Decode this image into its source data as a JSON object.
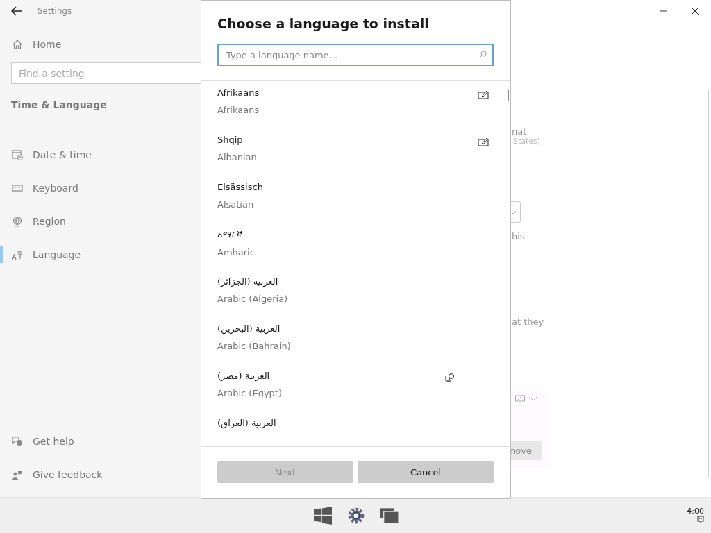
{
  "window": {
    "title": "Settings"
  },
  "sidebar": {
    "home": "Home",
    "search": {
      "placeholder": "Find a setting"
    },
    "section": "Time & Language",
    "items": [
      {
        "label": "Date & time",
        "selected": false
      },
      {
        "label": "Keyboard",
        "selected": false
      },
      {
        "label": "Region",
        "selected": false
      },
      {
        "label": "Language",
        "selected": true
      }
    ],
    "footer": [
      "Get help",
      "Give feedback"
    ]
  },
  "background": {
    "texts": [
      "nat",
      "States)",
      "his",
      "at they"
    ],
    "button": "nove"
  },
  "dialog": {
    "title": "Choose a language to install",
    "search": {
      "placeholder": "Type a language name..."
    },
    "languages": [
      {
        "native": "Afrikaans",
        "english": "Afrikaans",
        "handwriting": true,
        "speech": false
      },
      {
        "native": "Shqip",
        "english": "Albanian",
        "handwriting": true,
        "speech": false
      },
      {
        "native": "Elsässisch",
        "english": "Alsatian",
        "handwriting": false,
        "speech": false
      },
      {
        "native": "አማርኛ",
        "english": "Amharic",
        "handwriting": false,
        "speech": false
      },
      {
        "native": "العربية (الجزائر)",
        "english": "Arabic (Algeria)",
        "handwriting": false,
        "speech": false
      },
      {
        "native": "العربية (البحرين)",
        "english": "Arabic (Bahrain)",
        "handwriting": false,
        "speech": false
      },
      {
        "native": "العربية (مصر)",
        "english": "Arabic (Egypt)",
        "handwriting": false,
        "speech": true
      },
      {
        "native": "العربية (العراق)",
        "handwriting": false,
        "speech": false
      }
    ],
    "buttons": [
      {
        "label": "Next",
        "disabled": true
      },
      {
        "label": "Cancel",
        "disabled": false
      }
    ]
  },
  "taskbar": {
    "clock": "4:00"
  }
}
